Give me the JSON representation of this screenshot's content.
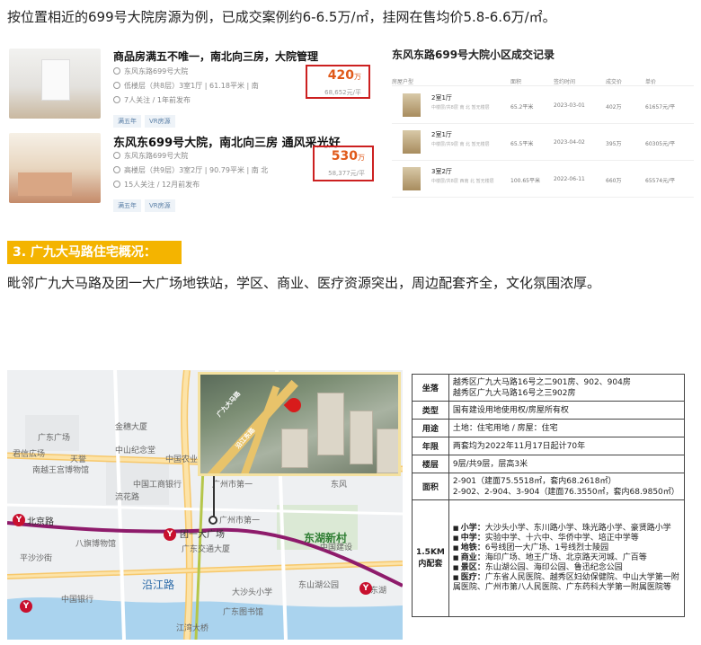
{
  "intro_text": "按位置相近的699号大院房源为例，已成交案例约6-6.5万/㎡，挂网在售均价5.8-6.6万/㎡。",
  "listings": [
    {
      "title": "商品房满五不唯一，南北向三房，大院管理",
      "line1": "东风东路699号大院",
      "line2": "低楼层（共8层）3室1厅 | 61.18平米 | 南",
      "line3": "7人关注 / 1年前发布",
      "tags": [
        "满五年",
        "VR房源"
      ],
      "price": "420",
      "price_unit": "万",
      "unit_price": "68,652元/平"
    },
    {
      "title": "东风东699号大院，南北向三房 通风采光好",
      "line1": "东风东路699号大院",
      "line2": "高楼层（共9层）3室2厅 | 90.79平米 | 南 北",
      "line3": "15人关注 / 12月前发布",
      "tags": [
        "满五年",
        "VR房源"
      ],
      "price": "530",
      "price_unit": "万",
      "unit_price": "58,377元/平"
    }
  ],
  "records": {
    "title": "东风东路699号大院小区成交记录",
    "headers": [
      "房屋户型",
      "面积",
      "签约时间",
      "成交价",
      "单价"
    ],
    "rows": [
      {
        "name": "2室1厅",
        "sub": "中楼层/共8层 南 北 暂无楼层",
        "area": "65.2平米",
        "date": "2023-03-01",
        "price": "402万",
        "unit": "61657元/平"
      },
      {
        "name": "2室1厅",
        "sub": "中楼层/共9层 南 北 暂无楼层",
        "area": "65.5平米",
        "date": "2023-04-02",
        "price": "395万",
        "unit": "60305元/平"
      },
      {
        "name": "3室2厅",
        "sub": "中楼层/共8层 西南 北 暂无楼层",
        "area": "100.65平米",
        "date": "2022-06-11",
        "price": "660万",
        "unit": "65574元/平"
      }
    ]
  },
  "section_heading": "3. 广九大马路住宅概况：",
  "section_desc": "毗邻广九大马路及团一大广场地铁站，学区、商业、医疗资源突出，周边配套齐全，文化氛围浓厚。",
  "map": {
    "labels": {
      "gd_square": "广东广场",
      "jinsui": "金穗大厦",
      "junsheng": "君信広场",
      "tianyu": "天誉",
      "nanyue": "南越王宫博物馆",
      "zhongshan": "中山纪念堂",
      "icbc": "中国工商银行",
      "agri": "中国农业银行",
      "guangzhou": "广州市第一",
      "liuhui": "流花路",
      "dongfeng": "东风",
      "beijing_road": "北京路",
      "bajiang": "八旗博物馆",
      "ping": "平沙沙街",
      "tuanyi": "团一大广场",
      "gd_traffic": "广东交通大厦",
      "liangqiang": "广州市第一",
      "gd_const": "中国建设",
      "dongshan": "东湖新村",
      "dongshan_lake": "东山湖公园",
      "yanjiang": "沿江路",
      "jianghai": "江湾大桥",
      "dashatou": "大沙头小学",
      "gd_library": "广东图书馆",
      "zhongyi": "中国银行",
      "donghu": "东湖"
    },
    "metro": [
      "Y",
      "Y",
      "Y",
      "Y"
    ],
    "inset_labels": [
      "广九大马路",
      "沿江东路"
    ]
  },
  "info_table": [
    {
      "key": "坐落",
      "value": "越秀区广九大马路16号之二901房、902、904房\n越秀区广九大马路16号之三902房"
    },
    {
      "key": "类型",
      "value": "国有建设用地使用权/房屋所有权"
    },
    {
      "key": "用途",
      "value": "土地：住宅用地 / 房屋：住宅"
    },
    {
      "key": "年限",
      "value": "两套均为2022年11月17日起计70年"
    },
    {
      "key": "楼层",
      "value": "9层/共9层，层高3米"
    },
    {
      "key": "面积",
      "value": "2-901（建面75.5518㎡，套内68.2618㎡）\n2-902、2-904、3-904（建面76.3550㎡，套内68.9850㎡）"
    },
    {
      "key": "1.5KM\n内配套",
      "items": [
        {
          "label": "小学：",
          "text": "大沙头小学、东川路小学、珠光路小学、豪贤路小学"
        },
        {
          "label": "中学：",
          "text": "实验中学、十六中、华侨中学、培正中学等"
        },
        {
          "label": "地铁：",
          "text": "6号线团一大广场、1号线烈士陵园"
        },
        {
          "label": "商业：",
          "text": "海印广场、地王广场、北京路天河城、广百等"
        },
        {
          "label": "景区：",
          "text": "东山湖公园、海印公园、鲁迅纪念公园"
        },
        {
          "label": "医疗：",
          "text": "广东省人民医院、越秀区妇幼保健院、中山大学第一附属医院、广州市第八人民医院、广东药科大学第一附属医院等"
        }
      ]
    }
  ]
}
